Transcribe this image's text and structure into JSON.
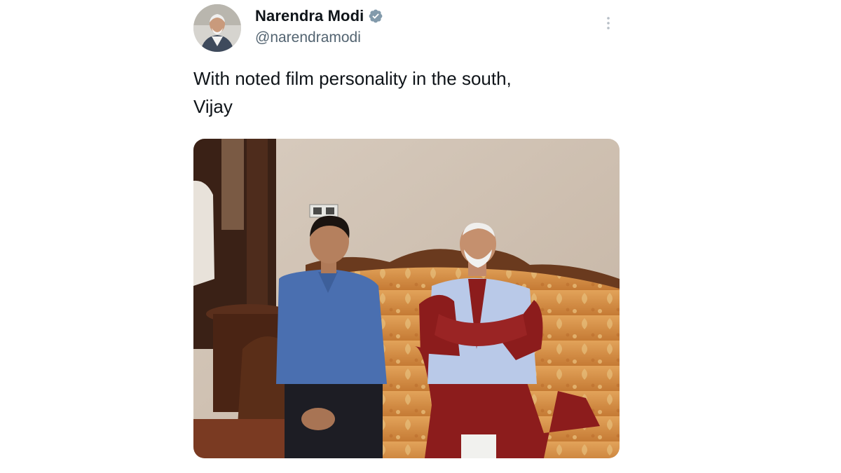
{
  "tweet": {
    "author": {
      "display_name": "Narendra Modi",
      "handle": "@narendramodi",
      "verified": true,
      "avatar_icon": "profile-photo"
    },
    "more_icon": "more-options-icon",
    "text": "With noted film personality in the south,\nVijay",
    "media": {
      "type": "photo",
      "icon": "photo-two-men-on-sofa"
    }
  },
  "colors": {
    "text_primary": "#0f1419",
    "text_secondary": "#536471",
    "verified_badge": "#829aab"
  }
}
